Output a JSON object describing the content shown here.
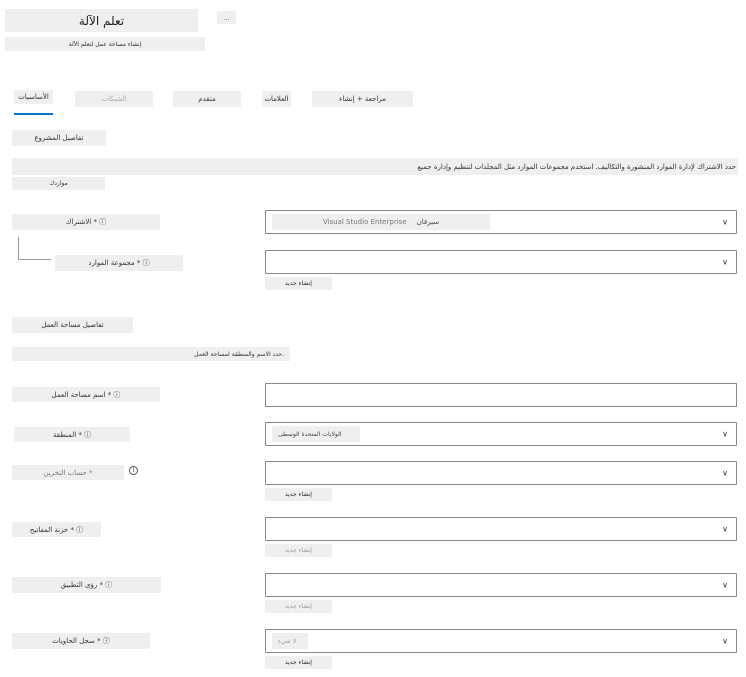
{
  "header": {
    "title": "تعلم الآلة",
    "more_label": "...",
    "subtitle": "إنشاء مساحة عمل لتعلم الآلة"
  },
  "tabs": [
    {
      "label": "الأساسيات"
    },
    {
      "label": "الشبكات"
    },
    {
      "label": "متقدم"
    },
    {
      "label": "العلامات"
    },
    {
      "label": "مراجعة + إنشاء"
    }
  ],
  "project_details": {
    "heading": "تفاصيل المشروع",
    "description": "حدد الاشتراك لإدارة الموارد المنشورة والتكاليف. استخدم مجموعات الموارد مثل المجلدات لتنظيم وإدارة جميع",
    "resources_label": "مواردك"
  },
  "fields": {
    "subscription": {
      "label": "الاشتراك * ⓘ",
      "value": "Visual Studio Enterprise",
      "value_prefix": "سيرفان"
    },
    "resource_group": {
      "label": "مجموعة الموارد * ⓘ",
      "value": "",
      "create_new": "إنشاء جديد"
    },
    "workspace_name": {
      "label": "اسم مساحة العمل * ⓘ",
      "value": ""
    },
    "region": {
      "label": "المنطقة * ⓘ",
      "value": "الولايات المتحدة الوسطى"
    },
    "storage_account": {
      "label": "حساب التخزين *",
      "value": "",
      "create_new": "إنشاء جديد"
    },
    "key_vault": {
      "label": "خزنة المفاتيح * ⓘ",
      "value": "",
      "create_new": "إنشاء جديد"
    },
    "app_insights": {
      "label": "رؤى التطبيق * ⓘ",
      "value": "",
      "create_new": "إنشاء جديد"
    },
    "container_registry": {
      "label": "سجل الحاويات * ⓘ",
      "value": "لا شيء",
      "create_new": "إنشاء جديد"
    }
  },
  "workspace_details": {
    "heading": "تفاصيل مساحة العمل",
    "description": "حدد الاسم والمنطقة لمساحة العمل."
  },
  "icons": {
    "chevron": "chevron-down-icon",
    "info": "info-icon"
  }
}
